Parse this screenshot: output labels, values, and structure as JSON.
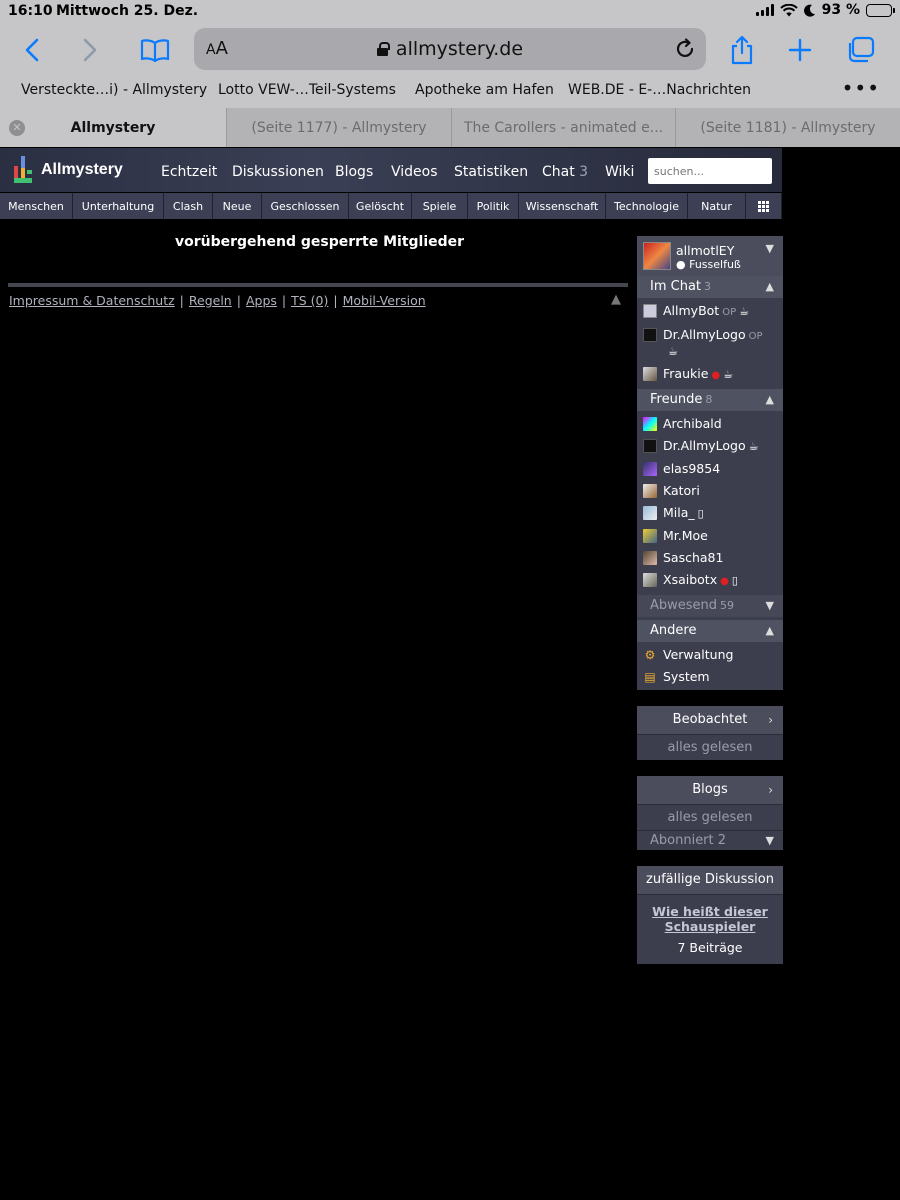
{
  "status_bar": {
    "time": "16:10",
    "date": "Mittwoch 25. Dez.",
    "battery": "93 %",
    "battery_level": 0.93
  },
  "browser": {
    "text_size_label": "AA",
    "url": "allmystery.de",
    "bookmarks": [
      "Versteckte…i) - Allmystery",
      "Lotto VEW-…Teil-Systems",
      "Apotheke am Hafen",
      "WEB.DE - E-…Nachrichten"
    ],
    "more": "•••",
    "tabs": [
      {
        "label": "Allmystery",
        "active": true
      },
      {
        "label": "(Seite 1177) - Allmystery",
        "active": false
      },
      {
        "label": "The Carollers - animated e...",
        "active": false
      },
      {
        "label": "(Seite 1181) - Allmystery",
        "active": false
      }
    ]
  },
  "site": {
    "logo": "Allmystery",
    "nav": {
      "echtzeit": "Echtzeit",
      "diskussionen": "Diskussionen",
      "blogs": "Blogs",
      "videos": "Videos",
      "statistiken": "Statistiken",
      "chat": "Chat",
      "chat_count": "3",
      "wiki": "Wiki"
    },
    "search_placeholder": "suchen...",
    "categories": [
      "Menschen",
      "Unterhaltung",
      "Clash",
      "Neue",
      "Geschlossen",
      "Gelöscht",
      "Spiele",
      "Politik",
      "Wissenschaft",
      "Technologie",
      "Natur"
    ],
    "page_title": "vorübergehend gesperrte Mitglieder",
    "footer": {
      "impressum": "Impressum & Datenschutz",
      "regeln": "Regeln",
      "apps": "Apps",
      "ts": "TS (0)",
      "mobil": "Mobil-Version",
      "separator": "|"
    }
  },
  "sidebar": {
    "user": {
      "name": "allmotlEY",
      "status": "Fusselfuß"
    },
    "im_chat": {
      "title": "Im Chat",
      "count": "3",
      "users": [
        {
          "name": "AllmyBot",
          "op": "OP"
        },
        {
          "name": "Dr.AllmyLogo",
          "op": "OP"
        },
        {
          "name": "Fraukie"
        }
      ]
    },
    "freunde": {
      "title": "Freunde",
      "count": "8",
      "users": [
        "Archibald",
        "Dr.AllmyLogo",
        "elas9854",
        "Katori",
        "Mila_",
        "Mr.Moe",
        "Sascha81",
        "Xsaibotx"
      ]
    },
    "abwesend": {
      "title": "Abwesend",
      "count": "59"
    },
    "andere": {
      "title": "Andere",
      "items": [
        "Verwaltung",
        "System"
      ]
    },
    "beobachtet": {
      "title": "Beobachtet",
      "status": "alles gelesen"
    },
    "blogs": {
      "title": "Blogs",
      "status": "alles gelesen",
      "abonniert": "Abonniert",
      "abonniert_count": "2"
    },
    "zufall": {
      "title": "zufällige Diskussion",
      "link": "Wie heißt dieser Schauspieler",
      "posts": "7 Beiträge"
    }
  },
  "colors": {
    "ios_blue": "#0a7aff",
    "header_bg": "#2b2f42",
    "sidebar_bg": "#3c3e4d",
    "online_dot": "#e02020"
  }
}
